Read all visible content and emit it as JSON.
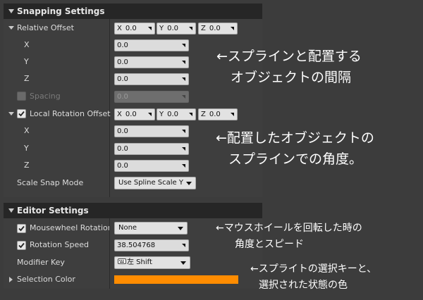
{
  "snapping": {
    "title": "Snapping Settings",
    "relative_offset": {
      "label": "Relative Offset",
      "x_axis": "X",
      "x_val": "0.0",
      "y_axis": "Y",
      "y_val": "0.0",
      "z_axis": "Z",
      "z_val": "0.0"
    },
    "rel_x": {
      "label": "X",
      "value": "0.0"
    },
    "rel_y": {
      "label": "Y",
      "value": "0.0"
    },
    "rel_z": {
      "label": "Z",
      "value": "0.0"
    },
    "spacing": {
      "label": "Spacing",
      "value": "0.0",
      "checked": false,
      "enabled": false
    },
    "local_rotation_offset": {
      "label": "Local Rotation Offset",
      "checked": true,
      "x_axis": "X",
      "x_val": "0.0",
      "y_axis": "Y",
      "y_val": "0.0",
      "z_axis": "Z",
      "z_val": "0.0"
    },
    "rot_x": {
      "label": "X",
      "value": "0.0"
    },
    "rot_y": {
      "label": "Y",
      "value": "0.0"
    },
    "rot_z": {
      "label": "Z",
      "value": "0.0"
    },
    "scale_snap_mode": {
      "label": "Scale Snap Mode",
      "value": "Use Spline Scale Y"
    }
  },
  "editor": {
    "title": "Editor Settings",
    "mousewheel_rotation": {
      "label": "Mousewheel Rotation A",
      "checked": true,
      "value": "None"
    },
    "rotation_speed": {
      "label": "Rotation Speed",
      "checked": true,
      "value": "38.504768"
    },
    "modifier_key": {
      "label": "Modifier Key",
      "value": "左 Shift",
      "icon": "keyboard-icon"
    },
    "selection_color": {
      "label": "Selection Color",
      "color": "#ff8c00"
    }
  },
  "annotations": {
    "a1_line1": "←スプラインと配置する",
    "a1_line2": "オブジェクトの間隔",
    "a2_line1": "←配置したオブジェクトの",
    "a2_line2": "スプラインでの角度。",
    "a3_line1": "←マウスホイールを回転した時の",
    "a3_line2": "角度とスピード",
    "a4_line1": "←スプライトの選択キーと、",
    "a4_line2": "選択された状態の色"
  },
  "colors": {
    "background": "#3c3c3c",
    "header": "#262626",
    "field": "#dcdcdc",
    "accent_orange": "#ff8c00"
  }
}
